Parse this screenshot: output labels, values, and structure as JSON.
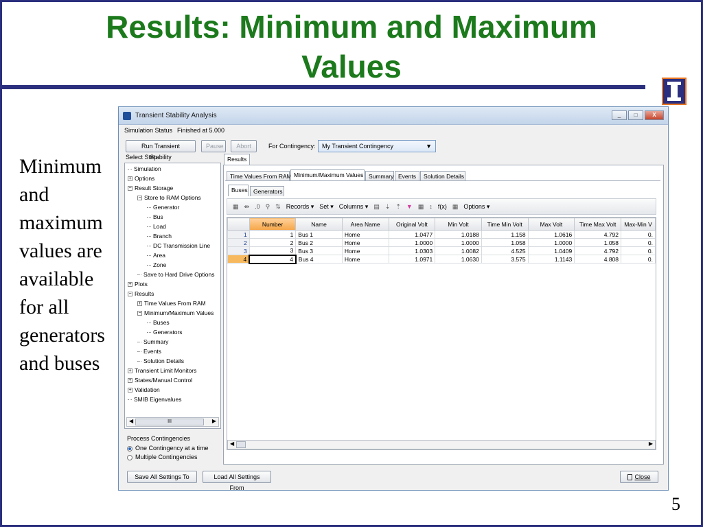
{
  "slide": {
    "title_line1": "Results: Minimum and Maximum",
    "title_line2": "Values",
    "side_text": [
      "Minimum",
      "and",
      "maximum",
      "values are",
      "available",
      "for all",
      "generators",
      "and buses"
    ],
    "page_number": "5",
    "colors": {
      "title": "#1c7a1c",
      "rule": "#2b2f7e",
      "logo_accent": "#e87722"
    },
    "logo_icon": "university-i-logo-icon"
  },
  "window": {
    "title": "Transient Stability Analysis",
    "controls": {
      "minimize": "_",
      "maximize": "□",
      "close": "X"
    },
    "status_label": "Simulation Status",
    "status_value": "Finished at 5.000",
    "buttons": {
      "run": "Run Transient Stability",
      "pause": "Pause",
      "abort": "Abort"
    },
    "contingency_label": "For Contingency:",
    "contingency_value": "My Transient Contingency",
    "select_step_label": "Select Step",
    "tree": [
      {
        "label": "Simulation",
        "level": 0,
        "type": "leaf"
      },
      {
        "label": "Options",
        "level": 0,
        "type": "plus"
      },
      {
        "label": "Result Storage",
        "level": 0,
        "type": "minus"
      },
      {
        "label": "Store to RAM Options",
        "level": 1,
        "type": "minus"
      },
      {
        "label": "Generator",
        "level": 2,
        "type": "leaf"
      },
      {
        "label": "Bus",
        "level": 2,
        "type": "leaf"
      },
      {
        "label": "Load",
        "level": 2,
        "type": "leaf"
      },
      {
        "label": "Branch",
        "level": 2,
        "type": "leaf"
      },
      {
        "label": "DC Transmission Line",
        "level": 2,
        "type": "leaf"
      },
      {
        "label": "Area",
        "level": 2,
        "type": "leaf"
      },
      {
        "label": "Zone",
        "level": 2,
        "type": "leaf"
      },
      {
        "label": "Save to Hard Drive Options",
        "level": 1,
        "type": "leaf"
      },
      {
        "label": "Plots",
        "level": 0,
        "type": "plus"
      },
      {
        "label": "Results",
        "level": 0,
        "type": "minus"
      },
      {
        "label": "Time Values From RAM",
        "level": 1,
        "type": "plus"
      },
      {
        "label": "Minimum/Maximum Values",
        "level": 1,
        "type": "minus"
      },
      {
        "label": "Buses",
        "level": 2,
        "type": "leaf"
      },
      {
        "label": "Generators",
        "level": 2,
        "type": "leaf"
      },
      {
        "label": "Summary",
        "level": 1,
        "type": "leaf"
      },
      {
        "label": "Events",
        "level": 1,
        "type": "leaf"
      },
      {
        "label": "Solution Details",
        "level": 1,
        "type": "leaf"
      },
      {
        "label": "Transient Limit Monitors",
        "level": 0,
        "type": "plus"
      },
      {
        "label": "States/Manual Control",
        "level": 0,
        "type": "plus"
      },
      {
        "label": "Validation",
        "level": 0,
        "type": "plus"
      },
      {
        "label": "SMIB Eigenvalues",
        "level": 0,
        "type": "leaf"
      }
    ],
    "tree_scroll_glyph": "III",
    "process_label": "Process Contingencies",
    "radio_one": "One Contingency at a time",
    "radio_multiple": "Multiple Contingencies",
    "results_tab": "Results",
    "result_tabs": [
      "Time Values From RAM",
      "Minimum/Maximum Values",
      "Summary",
      "Events",
      "Solution Details"
    ],
    "sub_tabs": [
      "Buses",
      "Generators"
    ],
    "toolbar": {
      "records": "Records ▾",
      "set": "Set ▾",
      "columns": "Columns ▾",
      "fx": "f(x)",
      "options": "Options ▾"
    },
    "table": {
      "columns": [
        "Number",
        "Name",
        "Area Name",
        "Original Volt",
        "Min Volt",
        "Time Min Volt",
        "Max Volt",
        "Time Max Volt",
        "Max-Min V"
      ],
      "rows": [
        {
          "idx": "1",
          "cells": [
            "1",
            "Bus 1",
            "Home",
            "1.0477",
            "1.0188",
            "1.158",
            "1.0616",
            "4.792",
            "0."
          ]
        },
        {
          "idx": "2",
          "cells": [
            "2",
            "Bus 2",
            "Home",
            "1.0000",
            "1.0000",
            "1.058",
            "1.0000",
            "1.058",
            "0."
          ]
        },
        {
          "idx": "3",
          "cells": [
            "3",
            "Bus 3",
            "Home",
            "1.0303",
            "1.0082",
            "4.525",
            "1.0409",
            "4.792",
            "0."
          ]
        },
        {
          "idx": "4",
          "cells": [
            "4",
            "Bus 4",
            "Home",
            "1.0971",
            "1.0630",
            "3.575",
            "1.1143",
            "4.808",
            "0."
          ]
        }
      ]
    },
    "bottom_buttons": {
      "save": "Save All Settings To",
      "load": "Load All Settings From",
      "close": "Close"
    }
  }
}
